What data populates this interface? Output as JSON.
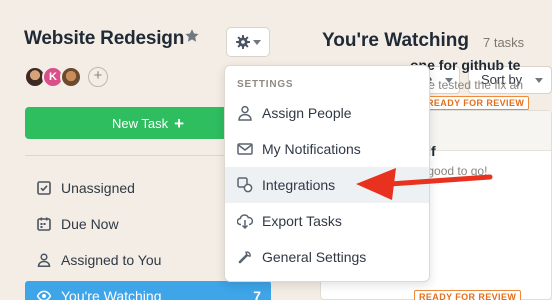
{
  "project": {
    "title": "Website Redesign",
    "avatar_initial": "K",
    "add_member": "+"
  },
  "sidebar": {
    "new_task_label": "New Task",
    "new_task_plus": "+",
    "items": [
      {
        "label": "Unassigned",
        "icon": "checkbox-icon"
      },
      {
        "label": "Due Now",
        "icon": "calendar-icon"
      },
      {
        "label": "Assigned to You",
        "icon": "person-icon"
      },
      {
        "label": "You're Watching",
        "icon": "eye-icon",
        "count": "7",
        "active": true
      }
    ]
  },
  "main": {
    "title": "You're Watching",
    "task_count": "7 tasks",
    "filter_partial": "e",
    "sort_label": "Sort by",
    "tasks": [
      {
        "title_partial": "one for github te",
        "subtitle_partial": ", I've tested the fix an",
        "badge": "READY FOR REVIEW"
      },
      {
        "title_partial": "fadf",
        "subtitle_partial": "These are good to go!",
        "badge": "READY FOR REVIEW"
      }
    ]
  },
  "settings_menu": {
    "heading": "SETTINGS",
    "items": [
      {
        "label": "Assign People",
        "icon": "person-icon"
      },
      {
        "label": "My Notifications",
        "icon": "envelope-icon"
      },
      {
        "label": "Integrations",
        "icon": "integrations-icon",
        "highlighted": true
      },
      {
        "label": "Export Tasks",
        "icon": "cloud-download-icon"
      },
      {
        "label": "General Settings",
        "icon": "wrench-icon"
      }
    ]
  },
  "colors": {
    "background": "#f3ede5",
    "primary_green": "#2ebd5f",
    "active_blue": "#3da5e8",
    "annotation_red": "#e8321f",
    "badge_orange": "#f08a3a"
  }
}
